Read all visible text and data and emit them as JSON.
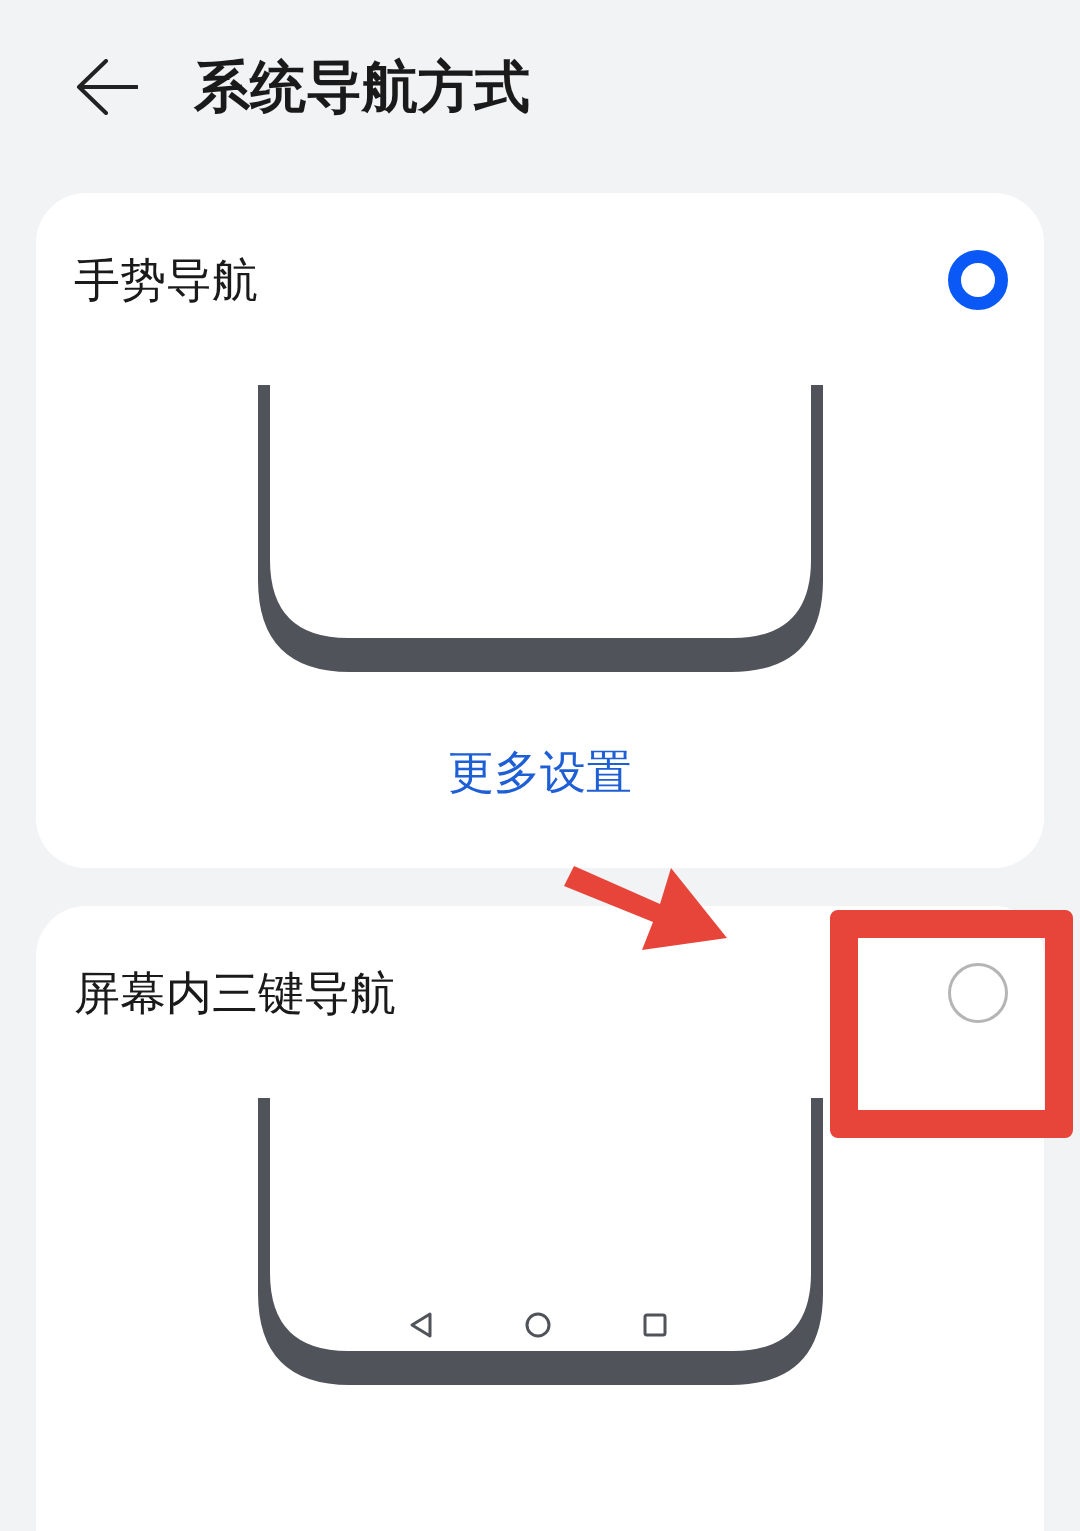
{
  "header": {
    "title": "系统导航方式"
  },
  "options": [
    {
      "title": "手势导航",
      "selected": true,
      "kind": "gesture",
      "link": "更多设置"
    },
    {
      "title": "屏幕内三键导航",
      "selected": false,
      "kind": "three_key"
    }
  ]
}
